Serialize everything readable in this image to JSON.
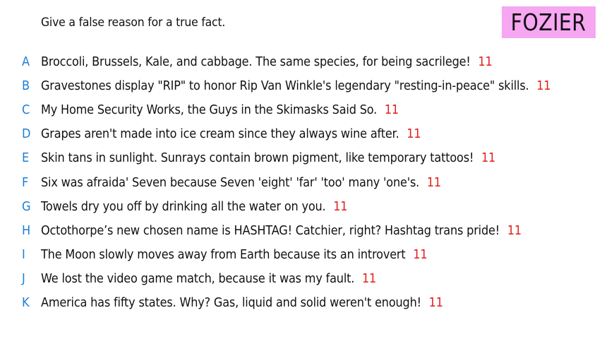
{
  "prompt": "Give a false reason for a true fact.",
  "player_name": "FOZIER",
  "colors": {
    "letter": "#1e7fd6",
    "score": "#e0201b",
    "badge_bg": "#f7a6f2",
    "text": "#111111"
  },
  "answers": [
    {
      "letter": "A",
      "text": "Broccoli, Brussels, Kale, and cabbage. The same species, for being sacrilege!",
      "score": "11"
    },
    {
      "letter": "B",
      "text": "Gravestones display \"RIP\" to honor Rip Van Winkle's legendary \"resting-in-peace\" skills.",
      "score": "11"
    },
    {
      "letter": "C",
      "text": "My Home Security Works, the Guys in the Skimasks Said So.",
      "score": "11"
    },
    {
      "letter": "D",
      "text": "Grapes aren't made into ice cream since they always wine after.",
      "score": "11"
    },
    {
      "letter": "E",
      "text": "Skin tans in sunlight. Sunrays contain brown pigment, like temporary tattoos!",
      "score": "11"
    },
    {
      "letter": "F",
      "text": "Six was afraida' Seven because Seven 'eight' 'far' 'too' many 'one's.",
      "score": "11"
    },
    {
      "letter": "G",
      "text": "Towels dry you off by drinking all the water on you.",
      "score": "11"
    },
    {
      "letter": "H",
      "text": "Octothorpe’s new chosen name is HASHTAG! Catchier, right? Hashtag trans pride!",
      "score": "11"
    },
    {
      "letter": "I",
      "text": "The Moon slowly moves away from Earth because its an introvert",
      "score": "11"
    },
    {
      "letter": "J",
      "text": "We lost the video game match, because it was my fault.",
      "score": "11"
    },
    {
      "letter": "K",
      "text": "America has fifty states. Why? Gas, liquid and solid weren't enough!",
      "score": "11"
    }
  ]
}
